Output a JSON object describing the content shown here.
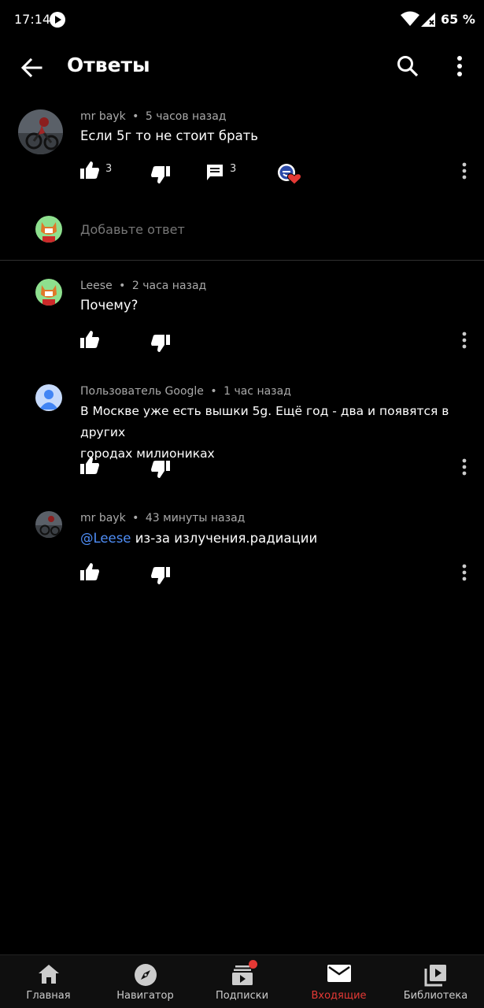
{
  "status_bar": {
    "time": "17:14",
    "battery": "65 %"
  },
  "app_bar": {
    "title": "Ответы",
    "icons": [
      "back-arrow-icon",
      "search-icon",
      "more-vert-icon"
    ]
  },
  "parent_comment": {
    "author": "mr bayk",
    "time": "5 часов назад",
    "text": "Если 5г то не стоит брать",
    "likes": "3",
    "replies": "3"
  },
  "reply_box": {
    "placeholder": "Добавьте ответ"
  },
  "replies": [
    {
      "author": "Leese",
      "time": "2 часа назад",
      "text": "Почему?"
    },
    {
      "author": "Пользователь Google",
      "time": "1 час назад",
      "text_line1": "В Москве уже есть вышки 5g. Ещё год - два и появятся в других",
      "text_line2": "городах милиониках"
    },
    {
      "author": "mr bayk",
      "time": "43 минуты назад",
      "mention": "@Leese",
      "text": " из-за излучения.радиации"
    }
  ],
  "meta_separator": "•",
  "bottom_nav": {
    "items": [
      {
        "label": "Главная",
        "icon": "home-icon"
      },
      {
        "label": "Навигатор",
        "icon": "compass-icon"
      },
      {
        "label": "Подписки",
        "icon": "subscriptions-icon"
      },
      {
        "label": "Входящие",
        "icon": "inbox-icon"
      },
      {
        "label": "Библиотека",
        "icon": "library-icon"
      }
    ],
    "active_index": 3
  },
  "colors": {
    "background": "#000000",
    "accent": "#e53935",
    "mention": "#4f8ef7"
  }
}
